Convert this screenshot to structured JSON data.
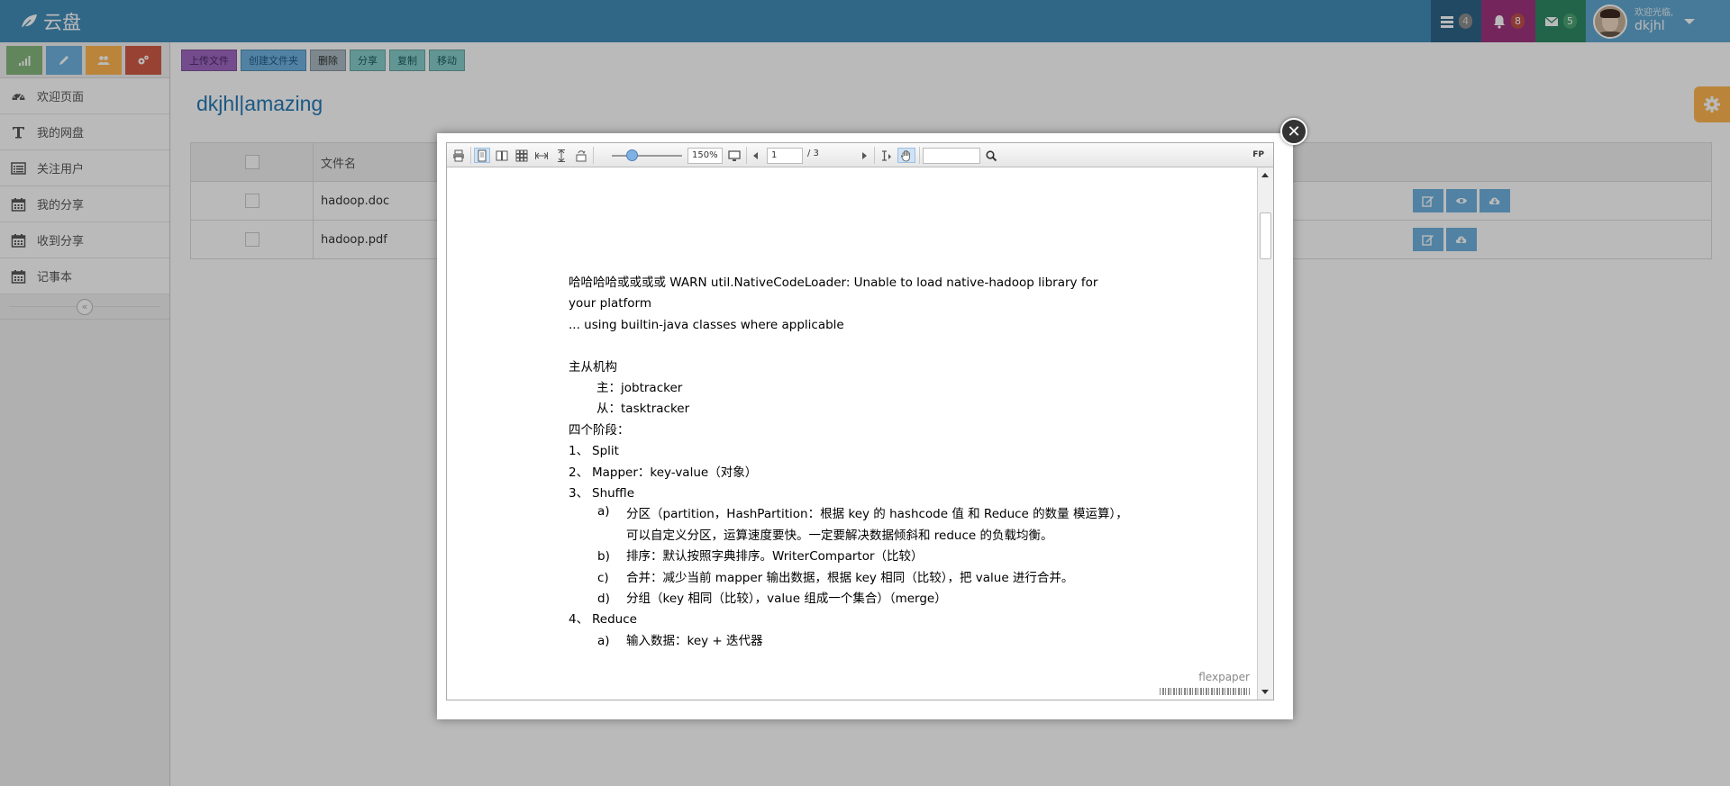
{
  "app": {
    "title": "云盘"
  },
  "navbar": {
    "tasks_count": "4",
    "notifications_count": "8",
    "messages_count": "5",
    "user": {
      "welcome": "欢迎光临,",
      "name": "dkjhl"
    }
  },
  "sidebar": {
    "items": [
      {
        "label": "欢迎页面",
        "icon": "dashboard-icon"
      },
      {
        "label": "我的网盘",
        "icon": "text-icon"
      },
      {
        "label": "关注用户",
        "icon": "list-icon"
      },
      {
        "label": "我的分享",
        "icon": "calendar-icon"
      },
      {
        "label": "收到分享",
        "icon": "calendar-icon"
      },
      {
        "label": "记事本",
        "icon": "calendar-icon"
      }
    ],
    "collapse_glyph": "«"
  },
  "toolbar": {
    "upload": "上传文件",
    "new_folder": "创建文件夹",
    "delete": "删除",
    "share": "分享",
    "copy": "复制",
    "move": "移动"
  },
  "page": {
    "title": "dkjhl|amazing"
  },
  "table": {
    "header": "文件名",
    "rows": [
      {
        "name": "hadoop.doc"
      },
      {
        "name": "hadoop.pdf"
      }
    ]
  },
  "viewer": {
    "zoom": "150%",
    "page": "1",
    "total_pages": "/ 3",
    "search_value": "",
    "logo": "FP",
    "brand": "flexpaper",
    "document": {
      "para1_line1": "哈哈哈哈或或或或 WARN util.NativeCodeLoader: Unable to load native-hadoop library for",
      "para1_line2": "your platform",
      "para1_line3": "... using builtin-java classes where applicable",
      "section1": "主从机构",
      "master": "主：jobtracker",
      "slave": "从：tasktracker",
      "section2": "四个阶段：",
      "stages": [
        {
          "num": "1、",
          "text": "Split"
        },
        {
          "num": "2、",
          "text": "Mapper：key-value（对象）"
        },
        {
          "num": "3、",
          "text": "Shuffle"
        },
        {
          "num": "4、",
          "text": "Reduce"
        }
      ],
      "shuffle_items": [
        {
          "mark": "a)",
          "text": "分区（partition，HashPartition：根据 key 的 hashcode 值  和  Reduce 的数量  模运算），可以自定义分区，运算速度要快。一定要解决数据倾斜和 reduce 的负载均衡。"
        },
        {
          "mark": "b)",
          "text": "排序：默认按照字典排序。WriterCompartor（比较）"
        },
        {
          "mark": "c)",
          "text": "合并：减少当前 mapper 输出数据，根据 key 相同（比较），把  value 进行合并。"
        },
        {
          "mark": "d)",
          "text": "分组（key 相同（比较），value 组成一个集合）（merge）"
        }
      ],
      "reduce_items": [
        {
          "mark": "a)",
          "text": "输入数据：key + 迭代器"
        }
      ]
    }
  },
  "colors": {
    "navbar": "#438eb9",
    "title": "#2679b5",
    "settings": "#ffb752",
    "action": "#6fb3e0"
  }
}
